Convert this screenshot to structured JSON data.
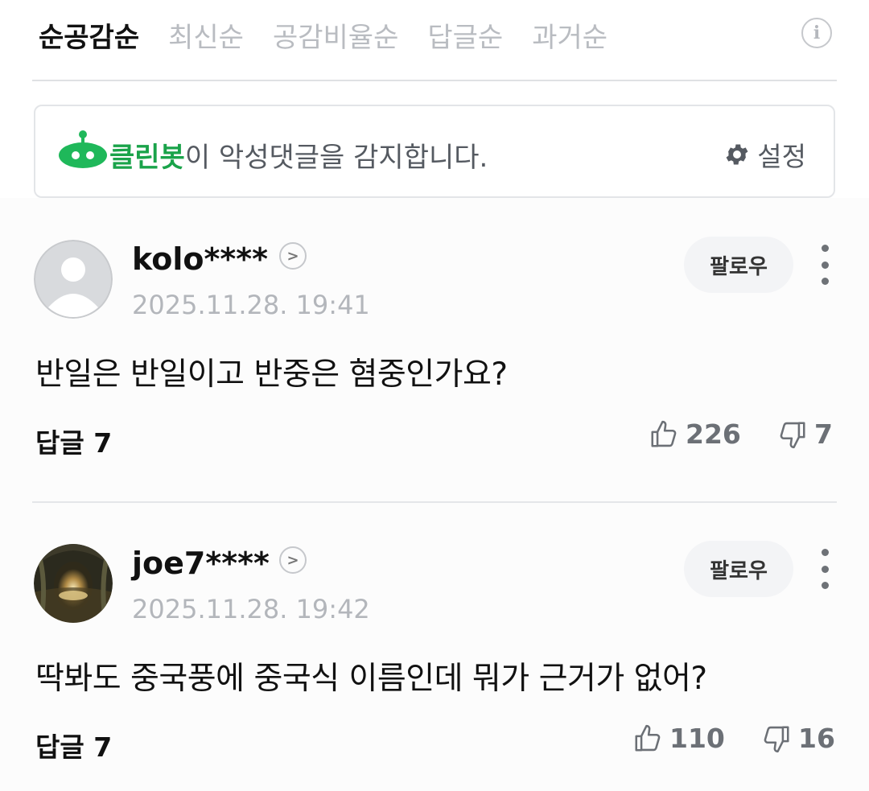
{
  "sort_tabs": [
    "순공감순",
    "최신순",
    "공감비율순",
    "답글순",
    "과거순"
  ],
  "info_icon": "info-circle-icon",
  "cleanbot": {
    "brand": "클린봇",
    "message": "이 악성댓글을 감지합니다.",
    "settings_label": "설정",
    "brand_color": "#1aa34a"
  },
  "comments": [
    {
      "username": "kolo****",
      "timestamp": "2025.11.28. 19:41",
      "follow_label": "팔로우",
      "text": "반일은 반일이고 반중은 혐중인가요?",
      "reply_label": "답글 7",
      "likes": "226",
      "dislikes": "7",
      "avatar": "default-avatar-icon"
    },
    {
      "username": "joe7****",
      "timestamp": "2025.11.28. 19:42",
      "follow_label": "팔로우",
      "text": "딱봐도 중국풍에 중국식 이름인데 뭐가 근거가 없어?",
      "reply_label": "답글 7",
      "likes": "110",
      "dislikes": "16",
      "avatar": "landscape-photo-avatar"
    }
  ]
}
